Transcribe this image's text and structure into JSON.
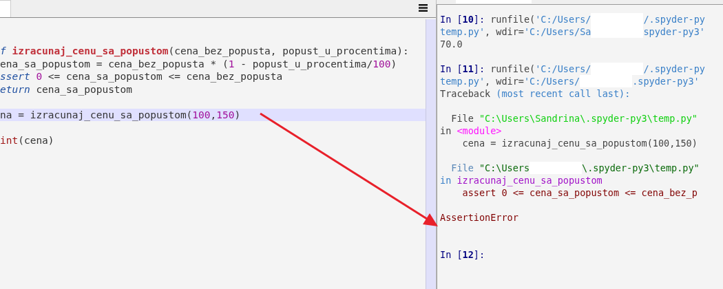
{
  "editor": {
    "lines": [
      {
        "kind": "code",
        "current": false,
        "tokens": [
          {
            "kind": "keyword",
            "text": "f"
          },
          {
            "kind": "def",
            "text": "izracunaj_cenu_sa_popustom"
          },
          {
            "kind": "plain",
            "text": "(cena_bez_popusta, popust_u_procentima):"
          }
        ]
      },
      {
        "kind": "code",
        "current": false,
        "tokens": [
          {
            "kind": "plain",
            "text": "ena_sa_popustom = cena_bez_popusta * ("
          },
          {
            "kind": "number",
            "text": "1"
          },
          {
            "kind": "plain",
            "text": " - popust_u_procentima/"
          },
          {
            "kind": "number",
            "text": "100"
          },
          {
            "kind": "plain",
            "text": ")"
          }
        ]
      },
      {
        "kind": "code",
        "current": false,
        "tokens": [
          {
            "kind": "keyword",
            "text": "ssert"
          },
          {
            "kind": "number",
            "text": "0"
          },
          {
            "kind": "plain",
            "text": " <= cena_sa_popustom <= cena_bez_popusta"
          }
        ]
      },
      {
        "kind": "code",
        "current": false,
        "tokens": [
          {
            "kind": "keyword",
            "text": "eturn"
          },
          {
            "kind": "plain",
            "text": " cena_sa_popustom"
          }
        ]
      },
      {
        "kind": "code",
        "current": true,
        "gap_before": true,
        "tokens": [
          {
            "kind": "plain",
            "text": "na = izracunaj_cenu_sa_popustom("
          },
          {
            "kind": "number",
            "text": "100"
          },
          {
            "kind": "plain",
            "text": ","
          },
          {
            "kind": "number",
            "text": "150"
          },
          {
            "kind": "plain",
            "text": ")"
          }
        ]
      },
      {
        "kind": "code",
        "current": false,
        "gap_before": true,
        "tokens": [
          {
            "kind": "builtin",
            "text": "int"
          },
          {
            "kind": "plain",
            "text": "(cena)"
          }
        ]
      }
    ]
  },
  "console": {
    "lines": [
      {
        "kind": "text",
        "tokens": [
          {
            "kind": "prompt",
            "text": "In ["
          },
          {
            "kind": "prompt_number",
            "text": "10"
          },
          {
            "kind": "prompt",
            "text": "]:"
          },
          {
            "kind": "plain",
            "text": " runfile("
          },
          {
            "kind": "string",
            "text": "'C:/Users/"
          },
          {
            "kind": "redacted"
          },
          {
            "kind": "string",
            "text": "/.spyder-py"
          }
        ]
      },
      {
        "kind": "text",
        "tokens": [
          {
            "kind": "string",
            "text": "temp.py'"
          },
          {
            "kind": "plain",
            "text": ", wdir="
          },
          {
            "kind": "string",
            "text": "'C:/Users/Sa"
          },
          {
            "kind": "redacted"
          },
          {
            "kind": "string",
            "text": "spyder-py3'"
          }
        ]
      },
      {
        "kind": "text",
        "tokens": [
          {
            "kind": "plain",
            "text": "70.0"
          }
        ]
      },
      {
        "kind": "blank"
      },
      {
        "kind": "text",
        "tokens": [
          {
            "kind": "prompt",
            "text": "In ["
          },
          {
            "kind": "prompt_number",
            "text": "11"
          },
          {
            "kind": "prompt",
            "text": "]:"
          },
          {
            "kind": "plain",
            "text": " runfile("
          },
          {
            "kind": "string",
            "text": "'C:/Users/"
          },
          {
            "kind": "redacted"
          },
          {
            "kind": "string",
            "text": "/.spyder-py"
          }
        ]
      },
      {
        "kind": "text",
        "tokens": [
          {
            "kind": "string",
            "text": "temp.py'"
          },
          {
            "kind": "plain",
            "text": ", wdir="
          },
          {
            "kind": "string",
            "text": "'C:/Users/"
          },
          {
            "kind": "redacted"
          },
          {
            "kind": "string",
            "text": ".spyder-py3'"
          }
        ]
      },
      {
        "kind": "text",
        "tokens": [
          {
            "kind": "plain",
            "text": "Traceback "
          },
          {
            "kind": "string",
            "text": "(most recent call last):"
          }
        ]
      },
      {
        "kind": "blank"
      },
      {
        "kind": "text",
        "tokens": [
          {
            "kind": "plain",
            "text": "  File "
          },
          {
            "kind": "path_bright",
            "text": "\"C:\\Users\\Sandrina\\.spyder-py3\\temp.py\""
          }
        ]
      },
      {
        "kind": "text",
        "tokens": [
          {
            "kind": "plain",
            "text": "in "
          },
          {
            "kind": "module",
            "text": "<module>"
          }
        ]
      },
      {
        "kind": "text",
        "tokens": [
          {
            "kind": "plain",
            "text": "    cena = izracunaj_cenu_sa_popustom(100,150)"
          }
        ]
      },
      {
        "kind": "blank"
      },
      {
        "kind": "text",
        "tokens": [
          {
            "kind": "file",
            "text": "  File "
          },
          {
            "kind": "path_dark",
            "text": "\"C:\\Users"
          },
          {
            "kind": "redacted"
          },
          {
            "kind": "path_dark",
            "text": "\\.spyder-py3\\temp.py\""
          }
        ]
      },
      {
        "kind": "text",
        "tokens": [
          {
            "kind": "string",
            "text": "in "
          },
          {
            "kind": "funcname",
            "text": "izracunaj_cenu_sa_popustom"
          }
        ]
      },
      {
        "kind": "text",
        "tokens": [
          {
            "kind": "errcode",
            "text": "    assert 0 <= cena_sa_popustom <= cena_bez_p"
          }
        ]
      },
      {
        "kind": "blank"
      },
      {
        "kind": "text",
        "tokens": [
          {
            "kind": "error",
            "text": "AssertionError"
          }
        ]
      },
      {
        "kind": "blank"
      },
      {
        "kind": "blank"
      },
      {
        "kind": "text",
        "tokens": [
          {
            "kind": "prompt",
            "text": "In ["
          },
          {
            "kind": "prompt_number",
            "text": "12"
          },
          {
            "kind": "prompt",
            "text": "]:"
          }
        ]
      }
    ]
  }
}
